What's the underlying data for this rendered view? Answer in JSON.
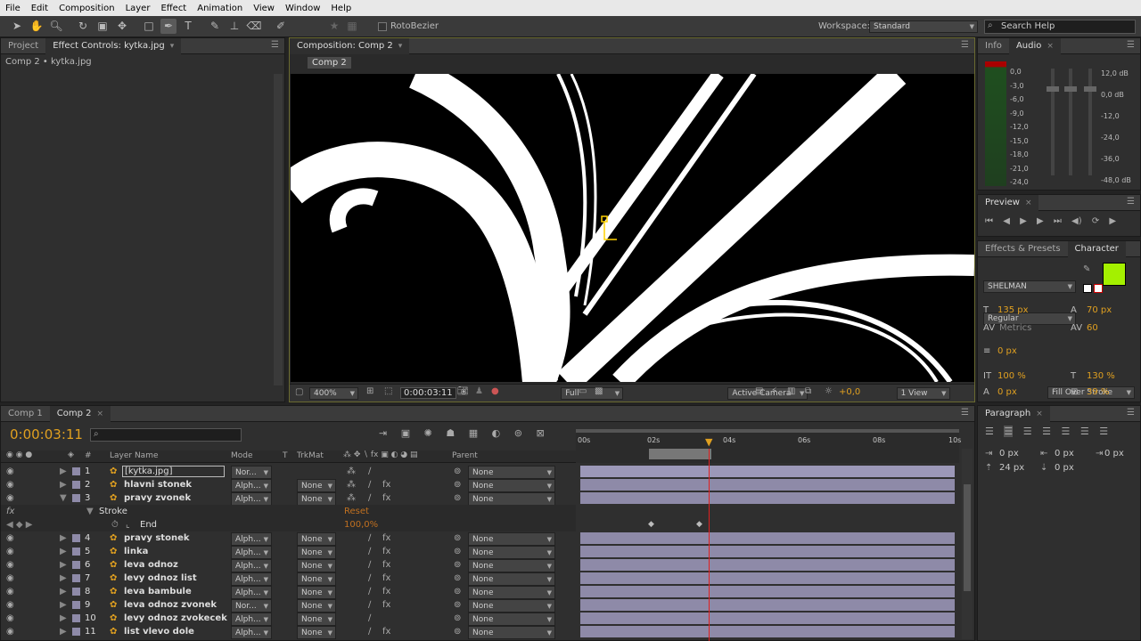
{
  "menu": [
    "File",
    "Edit",
    "Composition",
    "Layer",
    "Effect",
    "Animation",
    "View",
    "Window",
    "Help"
  ],
  "toolbar": {
    "rotobezier_label": "RotoBezier",
    "workspace_label": "Workspace:",
    "workspace_value": "Standard",
    "search_placeholder": "Search Help"
  },
  "left_panel": {
    "tabs": [
      "Project",
      "Effect Controls: kytka.jpg"
    ],
    "breadcrumb": "Comp 2 • kytka.jpg"
  },
  "composition": {
    "tab": "Composition: Comp 2",
    "subtab": "Comp 2",
    "zoom": "400%",
    "timecode": "0:00:03:11",
    "resolution": "Full",
    "camera": "Active Camera",
    "views": "1 View",
    "exposure": "+0,0"
  },
  "info_panel": {
    "tabs": [
      "Info",
      "Audio"
    ],
    "left_scale": [
      "0,0",
      "-3,0",
      "-6,0",
      "-9,0",
      "-12,0",
      "-15,0",
      "-18,0",
      "-21,0",
      "-24,0"
    ],
    "right_scale": [
      "12,0 dB",
      "0,0 dB",
      "-12,0",
      "-24,0",
      "-36,0",
      "-48,0 dB"
    ]
  },
  "preview_panel": {
    "title": "Preview"
  },
  "character_panel": {
    "tabs": [
      "Effects & Presets",
      "Character"
    ],
    "font": "SHELMAN",
    "style": "Regular",
    "size": "135 px",
    "leading": "70 px",
    "kerning": "Metrics",
    "tracking": "60",
    "stroke_width": "0 px",
    "stroke_type": "Fill Over Stroke",
    "vscale": "100 %",
    "hscale": "130 %",
    "baseline": "0 px",
    "tsume": "39 %",
    "fill_color": "#a4f000"
  },
  "paragraph_panel": {
    "title": "Paragraph",
    "indent_values": [
      "0 px",
      "0 px",
      "0 px",
      "24 px",
      "0 px"
    ]
  },
  "timeline": {
    "tabs": [
      "Comp 1",
      "Comp 2"
    ],
    "timecode": "0:00:03:11",
    "columns": {
      "num": "#",
      "layer_name": "Layer Name",
      "mode": "Mode",
      "t": "T",
      "trkmat": "TrkMat",
      "parent": "Parent"
    },
    "ruler": [
      "00s",
      "02s",
      "04s",
      "06s",
      "08s",
      "10s"
    ],
    "stroke_label": "Stroke",
    "reset_label": "Reset",
    "end_label": "End",
    "end_value": "100,0%",
    "layers": [
      {
        "num": "1",
        "name": "[kytka.jpg]",
        "mode": "Nor...",
        "trkmat": "",
        "parent": "None"
      },
      {
        "num": "2",
        "name": "hlavni stonek",
        "mode": "Alph...",
        "trkmat": "None",
        "parent": "None"
      },
      {
        "num": "3",
        "name": "pravy zvonek",
        "mode": "Alph...",
        "trkmat": "None",
        "parent": "None"
      },
      {
        "num": "4",
        "name": "pravy stonek",
        "mode": "Alph...",
        "trkmat": "None",
        "parent": "None"
      },
      {
        "num": "5",
        "name": "linka",
        "mode": "Alph...",
        "trkmat": "None",
        "parent": "None"
      },
      {
        "num": "6",
        "name": "leva odnoz",
        "mode": "Alph...",
        "trkmat": "None",
        "parent": "None"
      },
      {
        "num": "7",
        "name": "levy odnoz list",
        "mode": "Alph...",
        "trkmat": "None",
        "parent": "None"
      },
      {
        "num": "8",
        "name": "leva bambule",
        "mode": "Alph...",
        "trkmat": "None",
        "parent": "None"
      },
      {
        "num": "9",
        "name": "leva odnoz zvonek",
        "mode": "Nor...",
        "trkmat": "None",
        "parent": "None"
      },
      {
        "num": "10",
        "name": "levy odnoz zvokecek",
        "mode": "Alph...",
        "trkmat": "None",
        "parent": "None"
      },
      {
        "num": "11",
        "name": "list vlevo dole",
        "mode": "Alph...",
        "trkmat": "None",
        "parent": "None"
      }
    ]
  }
}
